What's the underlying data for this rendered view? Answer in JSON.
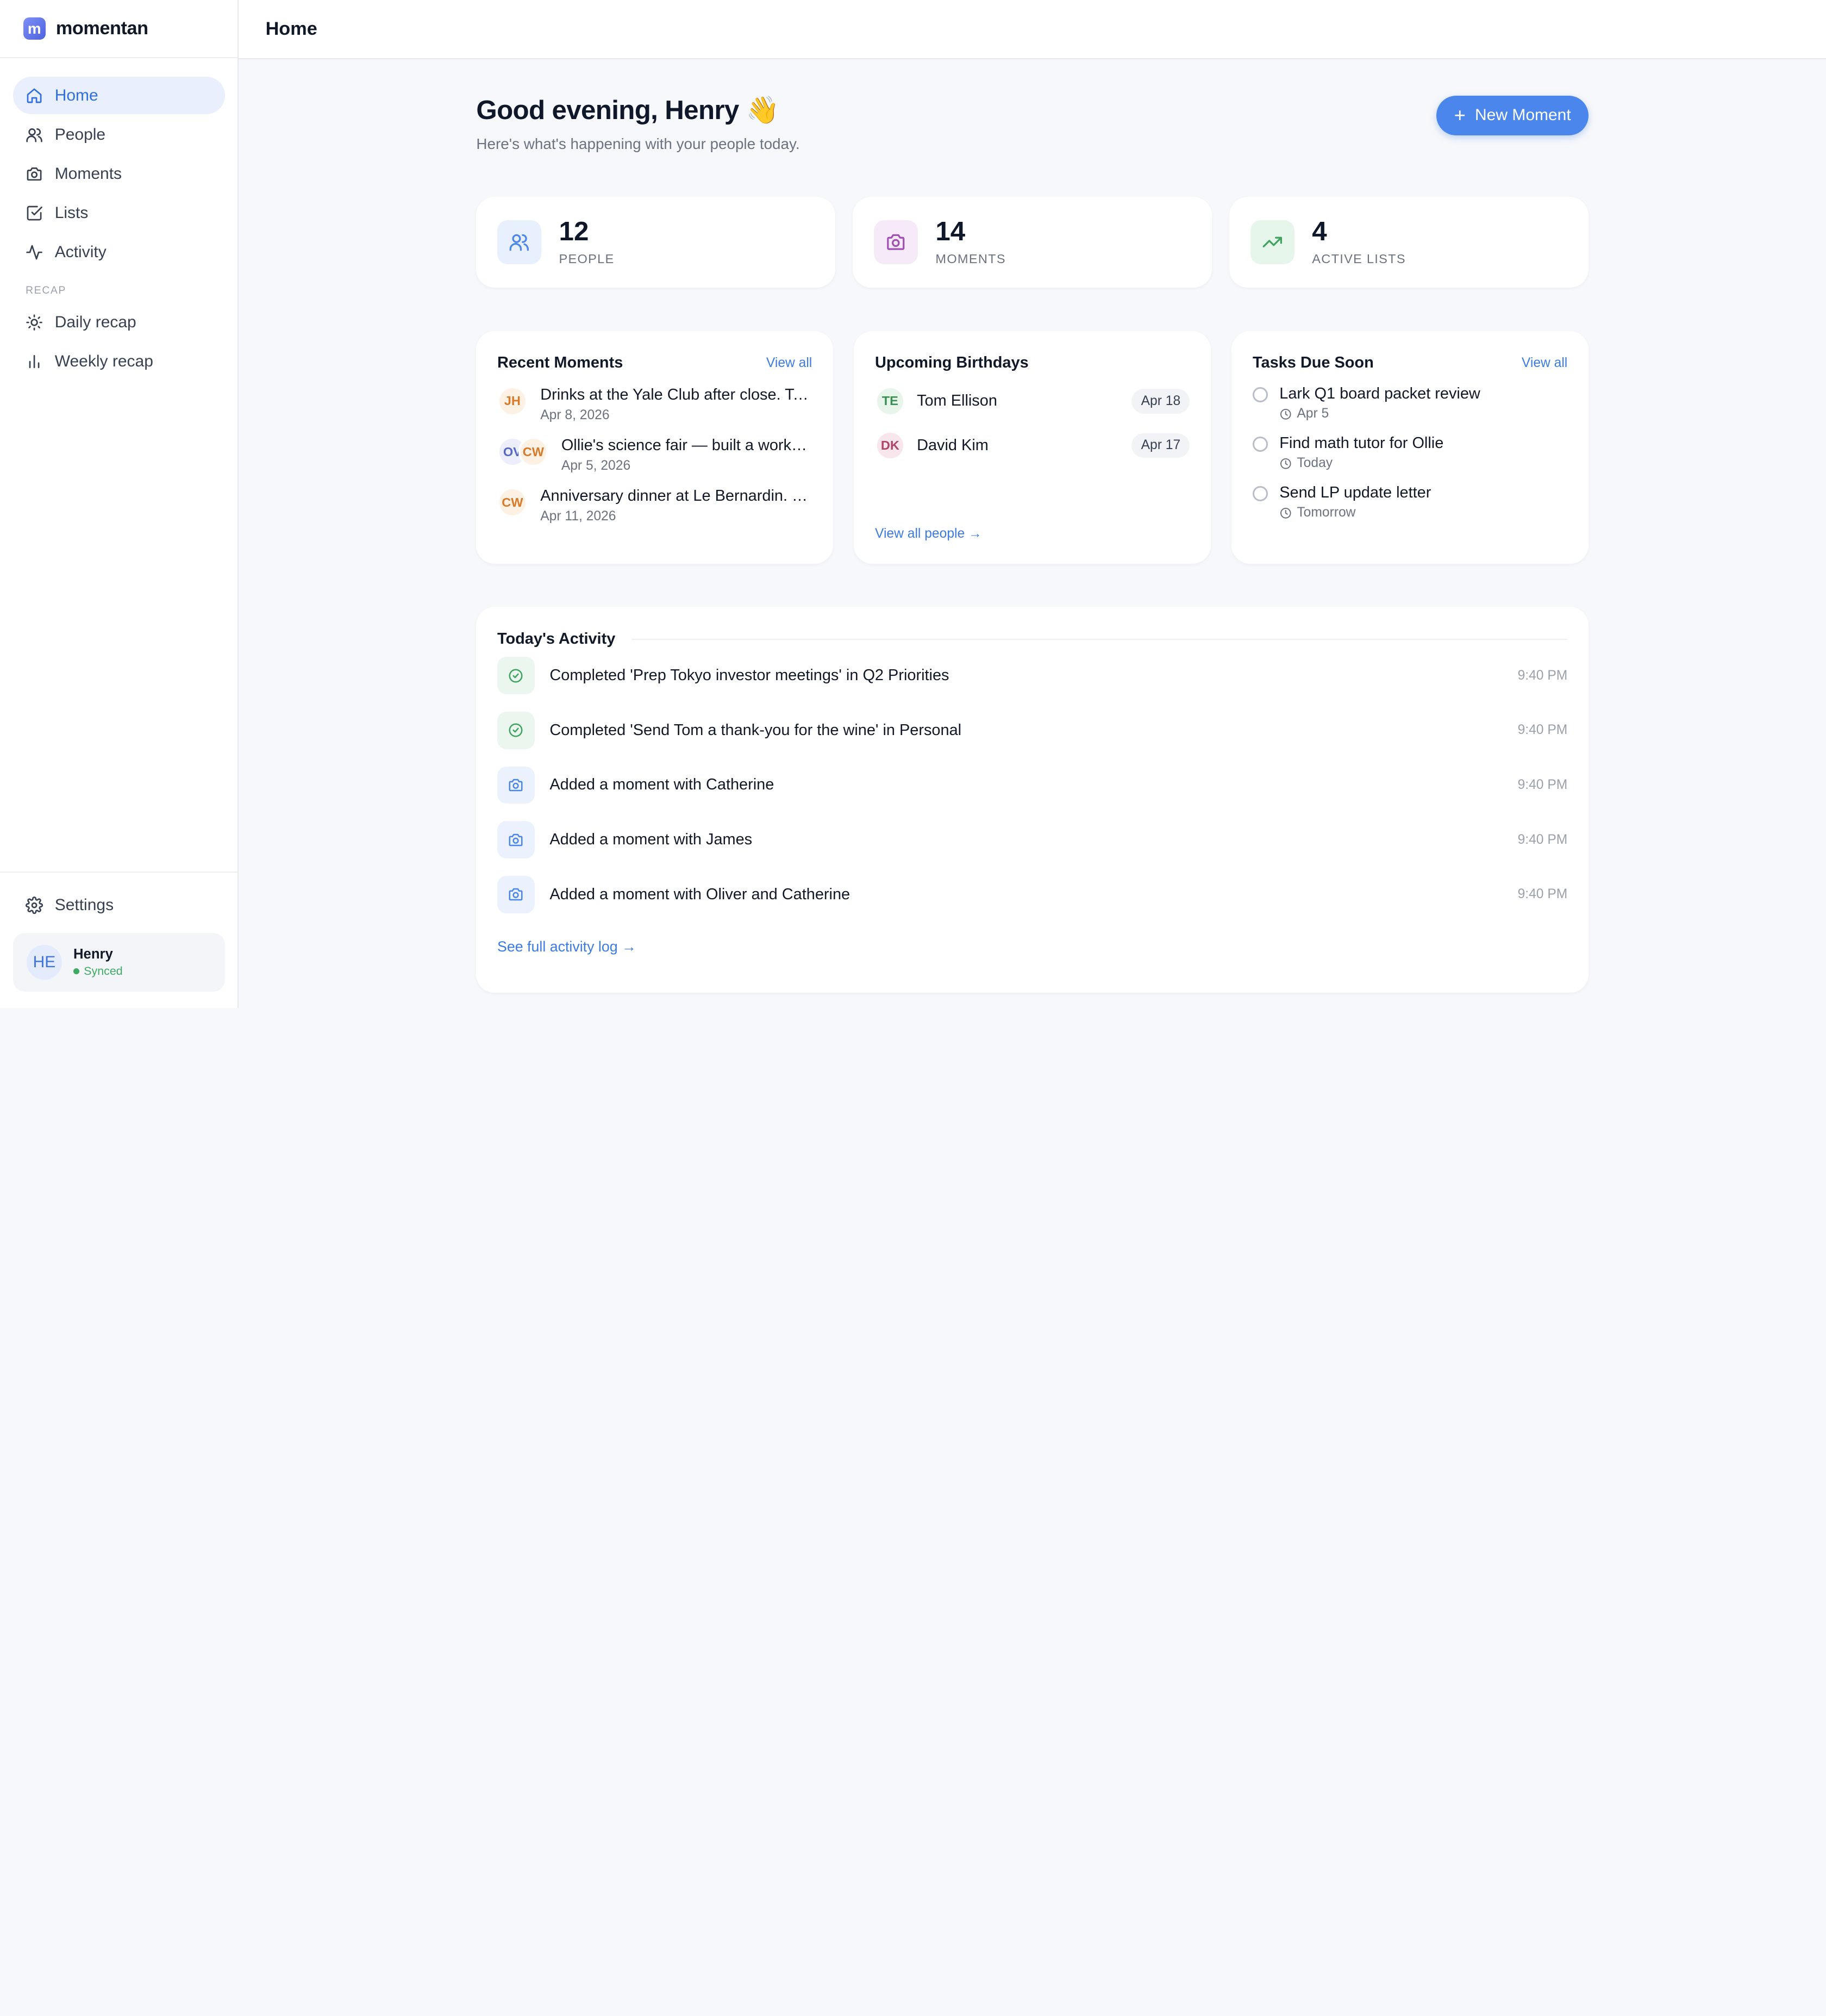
{
  "brand": {
    "name": "momentan",
    "logo_letter": "m"
  },
  "topbar": {
    "title": "Home"
  },
  "sidebar": {
    "items": [
      {
        "label": "Home",
        "icon": "home-icon",
        "active": true
      },
      {
        "label": "People",
        "icon": "people-icon"
      },
      {
        "label": "Moments",
        "icon": "camera-icon"
      },
      {
        "label": "Lists",
        "icon": "checkbox-icon"
      },
      {
        "label": "Activity",
        "icon": "activity-icon"
      }
    ],
    "section_label": "RECAP",
    "recap_items": [
      {
        "label": "Daily recap",
        "icon": "sun-icon"
      },
      {
        "label": "Weekly recap",
        "icon": "bar-chart-icon"
      }
    ],
    "settings_label": "Settings",
    "user": {
      "initials": "HE",
      "name": "Henry",
      "status": "Synced"
    }
  },
  "hero": {
    "greeting": "Good evening, Henry 👋",
    "subtitle": "Here's what's happening with your people today.",
    "new_button": "New Moment"
  },
  "stats": [
    {
      "value": "12",
      "label": "PEOPLE",
      "icon": "people-icon",
      "color": "#4a86ec",
      "bg": "#e9f0fd"
    },
    {
      "value": "14",
      "label": "MOMENTS",
      "icon": "camera-icon",
      "color": "#a24fb5",
      "bg": "#f6e9f8"
    },
    {
      "value": "4",
      "label": "ACTIVE LISTS",
      "icon": "trending-up-icon",
      "color": "#3ea35f",
      "bg": "#e6f6ea"
    }
  ],
  "recent_moments": {
    "title": "Recent Moments",
    "view_all": "View all",
    "items": [
      {
        "avatars": [
          "JH"
        ],
        "text": "Drinks at the Yale Club after close. Talked",
        "date": "Apr 8, 2026"
      },
      {
        "avatars": [
          "OV",
          "CW"
        ],
        "text": "Ollie's science fair — built a working model",
        "date": "Apr 5, 2026"
      },
      {
        "avatars": [
          "CW"
        ],
        "text": "Anniversary dinner at Le Bernardin. Catherine",
        "date": "Apr 11, 2026"
      }
    ]
  },
  "birthdays": {
    "title": "Upcoming Birthdays",
    "items": [
      {
        "initials": "TE",
        "name": "Tom Ellison",
        "date": "Apr 18"
      },
      {
        "initials": "DK",
        "name": "David Kim",
        "date": "Apr 17"
      }
    ],
    "view_all": "View all people →"
  },
  "tasks": {
    "title": "Tasks Due Soon",
    "view_all": "View all",
    "items": [
      {
        "title": "Lark Q1 board packet review",
        "due": "Apr 5"
      },
      {
        "title": "Find math tutor for Ollie",
        "due": "Today"
      },
      {
        "title": "Send LP update letter",
        "due": "Tomorrow"
      }
    ]
  },
  "activity": {
    "title": "Today's Activity",
    "items": [
      {
        "type": "completed",
        "text": "Completed 'Prep Tokyo investor meetings' in Q2 Priorities",
        "time": "9:40 PM"
      },
      {
        "type": "completed",
        "text": "Completed 'Send Tom a thank-you for the wine' in Personal",
        "time": "9:40 PM"
      },
      {
        "type": "moment",
        "text": "Added a moment with Catherine",
        "time": "9:40 PM"
      },
      {
        "type": "moment",
        "text": "Added a moment with James",
        "time": "9:40 PM"
      },
      {
        "type": "moment",
        "text": "Added a moment with Oliver and Catherine",
        "time": "9:40 PM"
      }
    ],
    "full_log": "See full activity log →"
  },
  "colors": {
    "accent": "#4a86ec",
    "link": "#3b7be3",
    "active_nav_bg": "#e9effd",
    "synced": "#3eaa64"
  }
}
